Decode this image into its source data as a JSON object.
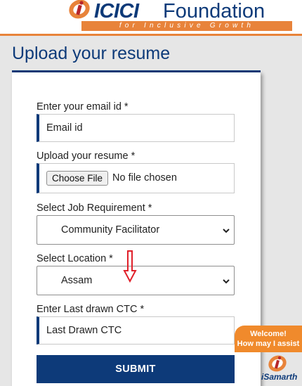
{
  "header": {
    "brand": "ICICI",
    "brand_word": "Foundation",
    "tagline": "for Inclusive Growth",
    "accent_color": "#e8833a",
    "primary_color": "#0d3a79"
  },
  "page": {
    "title": "Upload your resume"
  },
  "form": {
    "email": {
      "label": "Enter your email id *",
      "placeholder": "Email id"
    },
    "resume": {
      "label": "Upload your resume *",
      "button_label": "Choose File",
      "status": "No file chosen"
    },
    "job": {
      "label": "Select Job Requirement *",
      "selected": "Community Facilitator"
    },
    "location": {
      "label": "Select Location *",
      "selected": "Assam"
    },
    "ctc": {
      "label": "Enter Last drawn CTC *",
      "placeholder": "Last Drawn CTC"
    },
    "submit_label": "SUBMIT"
  },
  "chat": {
    "greeting": "Welcome!",
    "prompt": "How may I assist",
    "brand": "iSamarth"
  },
  "icons": [
    "icici-logo-icon",
    "chevron-down-icon",
    "red-down-arrow-icon",
    "isamarth-logo-icon"
  ]
}
